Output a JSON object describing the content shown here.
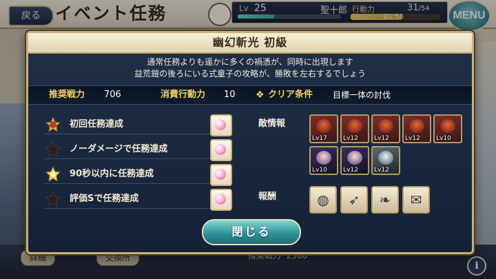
{
  "header": {
    "back_label": "戻る",
    "event_title": "イベント任務",
    "level_label": "Lv",
    "level": "25",
    "player_name": "聖十郎",
    "stamina_label": "行動力",
    "stamina_current": "31",
    "stamina_max": "/54",
    "stamina_timer": "01:58",
    "stamina_fraction": 0.57,
    "exp_fraction": 0.35,
    "menu_label": "MENU"
  },
  "background": {
    "bottom_left_label": "詳細",
    "bottom_mid_label": "交換所",
    "bottom_power_label": "推奨戦力",
    "bottom_power_value": "2360"
  },
  "modal": {
    "title": "幽幻斬光 初級",
    "description_line1": "通常任務よりも遥かに多くの禍憑が、同時に出現します",
    "description_line2": "益荒鎧の後ろにいる式童子の攻略が、勝敗を左右するでしょう",
    "stats": {
      "power_label": "推奨戦力",
      "power_value": "706",
      "cost_label": "消費行動力",
      "cost_value": "10",
      "clear_label": "クリア条件",
      "clear_value": "目標一体の討伐"
    },
    "missions": [
      {
        "text": "初回任務達成",
        "medal": "red"
      },
      {
        "text": "ノーダメージで任務達成",
        "medal": "dark"
      },
      {
        "text": "90秒以内に任務達成",
        "medal": "gold"
      },
      {
        "text": "評価Sで任務達成",
        "medal": "dark"
      }
    ],
    "enemy_info_label": "敵情報",
    "enemies": [
      {
        "lv": "Lv17",
        "style": "red"
      },
      {
        "lv": "Lv12",
        "style": "red"
      },
      {
        "lv": "Lv12",
        "style": "red"
      },
      {
        "lv": "Lv12",
        "style": "red"
      },
      {
        "lv": "Lv10",
        "style": "red"
      },
      {
        "lv": "Lv10",
        "style": "purple"
      },
      {
        "lv": "Lv12",
        "style": "purple"
      },
      {
        "lv": "Lv12",
        "style": "grey"
      }
    ],
    "reward_label": "報酬",
    "rewards": [
      "orb-icon",
      "feather-icon",
      "scroll-icon",
      "talisman-icon"
    ],
    "close_label": "閉じる"
  }
}
